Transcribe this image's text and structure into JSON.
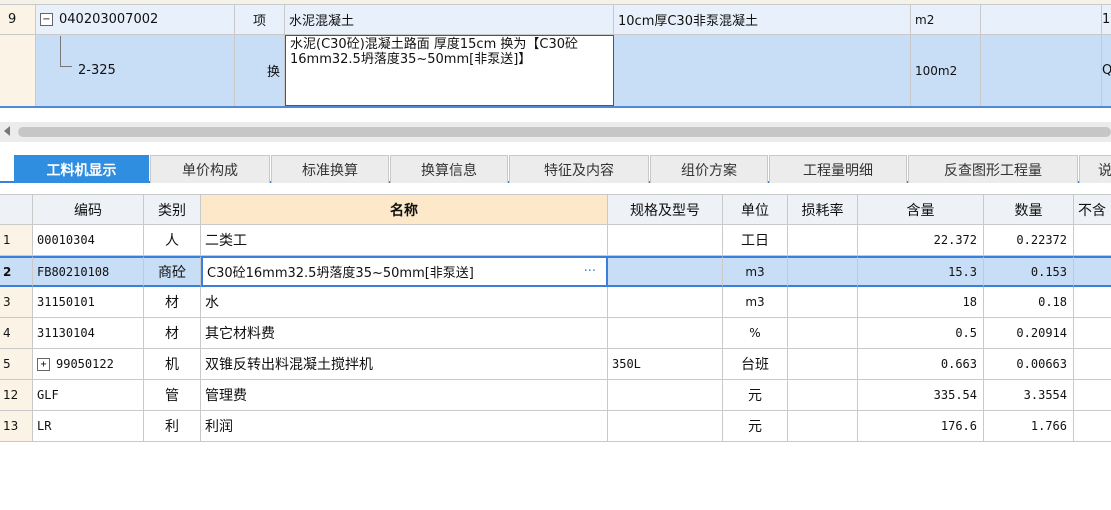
{
  "top_grid": {
    "rows": [
      {
        "index": "9",
        "code": "040203007002",
        "expand_symbol": "−",
        "type": "项",
        "name": "水泥混凝土",
        "feature": "10cm厚C30非泵混凝土",
        "unit": "m2",
        "extra": "1"
      },
      {
        "index": "",
        "code": "2-325",
        "type": "换",
        "name": "水泥(C30砼)混凝土路面 厚度15cm  换为【C30砼16mm32.5坍落度35~50mm[非泵送]】",
        "feature": "",
        "unit": "100m2",
        "extra": "Q"
      }
    ]
  },
  "tabs": [
    {
      "label": "工料机显示",
      "active": true
    },
    {
      "label": "单价构成"
    },
    {
      "label": "标准换算"
    },
    {
      "label": "换算信息"
    },
    {
      "label": "特征及内容"
    },
    {
      "label": "组价方案"
    },
    {
      "label": "工程量明细"
    },
    {
      "label": "反查图形工程量"
    },
    {
      "label": "说"
    }
  ],
  "grid": {
    "headers": [
      "",
      "编码",
      "类别",
      "名称",
      "规格及型号",
      "单位",
      "损耗率",
      "含量",
      "数量",
      "不含"
    ],
    "rows": [
      {
        "index": "1",
        "code": "00010304",
        "category": "人",
        "name": "二类工",
        "spec": "",
        "unit": "工日",
        "loss": "",
        "content": "22.372",
        "qty": "0.22372"
      },
      {
        "index": "2",
        "code": "FB80210108",
        "category": "商砼",
        "name": "C30砼16mm32.5坍落度35~50mm[非泵送]",
        "spec": "",
        "unit": "m3",
        "loss": "",
        "content": "15.3",
        "qty": "0.153",
        "selected": true,
        "ellipsis": "···"
      },
      {
        "index": "3",
        "code": "31150101",
        "category": "材",
        "name": "水",
        "spec": "",
        "unit": "m3",
        "loss": "",
        "content": "18",
        "qty": "0.18"
      },
      {
        "index": "4",
        "code": "31130104",
        "category": "材",
        "name": "其它材料费",
        "spec": "",
        "unit": "%",
        "loss": "",
        "content": "0.5",
        "qty": "0.20914"
      },
      {
        "index": "5",
        "code": "99050122",
        "expand_symbol": "+",
        "category": "机",
        "name": "双锥反转出料混凝土搅拌机",
        "spec": "350L",
        "unit": "台班",
        "loss": "",
        "content": "0.663",
        "qty": "0.00663"
      },
      {
        "index": "12",
        "code": "GLF",
        "category": "管",
        "name": "管理费",
        "spec": "",
        "unit": "元",
        "loss": "",
        "content": "335.54",
        "qty": "3.3554"
      },
      {
        "index": "13",
        "code": "LR",
        "category": "利",
        "name": "利润",
        "spec": "",
        "unit": "元",
        "loss": "",
        "content": "176.6",
        "qty": "1.766"
      }
    ]
  },
  "colors": {
    "tab_active": "#2f8ee0",
    "selection": "#c8ddf6",
    "selection_border": "#3a7fdb",
    "name_header": "#fde9c9"
  }
}
